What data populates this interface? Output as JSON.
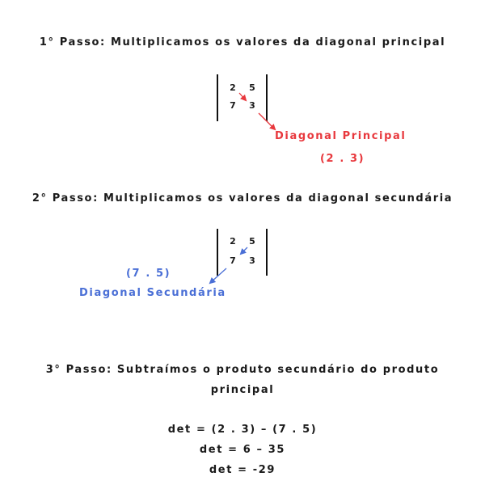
{
  "step1": {
    "title": "1° Passo: Multiplicamos os valores da diagonal principal",
    "matrix": [
      "2",
      "5",
      "7",
      "3"
    ],
    "label": "Diagonal Principal",
    "product": "(2 . 3)"
  },
  "step2": {
    "title": "2° Passo: Multiplicamos os valores da diagonal secundária",
    "matrix": [
      "2",
      "5",
      "7",
      "3"
    ],
    "product": "(7 . 5)",
    "label": "Diagonal Secundária"
  },
  "step3": {
    "title_line1": "3° Passo: Subtraímos o produto secundário do produto",
    "title_line2": "principal",
    "eq1": "det = (2 . 3) – (7 . 5)",
    "eq2": "det = 6 – 35",
    "eq3": "det = -29"
  },
  "colors": {
    "principal": "#e8383d",
    "secundaria": "#4a6fd6",
    "text": "#1a1a1a"
  }
}
